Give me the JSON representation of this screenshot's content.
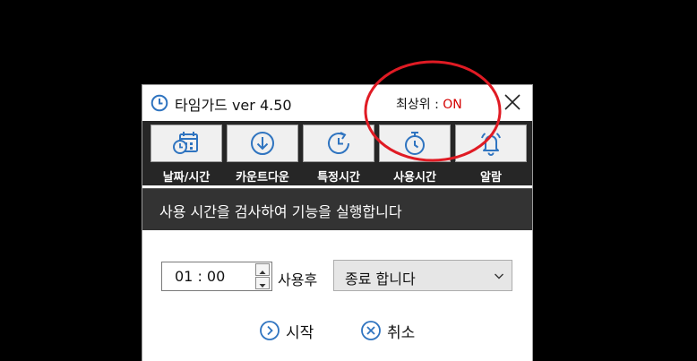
{
  "window": {
    "title": "타임가드 ver 4.50",
    "topmost_label": "최상위 :",
    "topmost_state": "ON"
  },
  "toolbar": {
    "items": [
      {
        "label": "날짜/시간",
        "icon": "calendar-clock-icon"
      },
      {
        "label": "카운트다운",
        "icon": "down-arrow-circle-icon"
      },
      {
        "label": "특정시간",
        "icon": "clock-refresh-icon"
      },
      {
        "label": "사용시간",
        "icon": "stopwatch-icon"
      },
      {
        "label": "알람",
        "icon": "bell-icon"
      }
    ]
  },
  "info": {
    "text": "사용 시간을 검사하여 기능을 실행합니다"
  },
  "form": {
    "time_value": "01 : 00",
    "after_label": "사용후",
    "action_selected": "종료 합니다"
  },
  "buttons": {
    "start": "시작",
    "cancel": "취소"
  },
  "colors": {
    "background": "#000000",
    "toolbar": "#262626",
    "info_bar": "#333333",
    "accent_blue": "#2f74c0",
    "on_state": "#d40000",
    "annotation": "#e01b24"
  }
}
